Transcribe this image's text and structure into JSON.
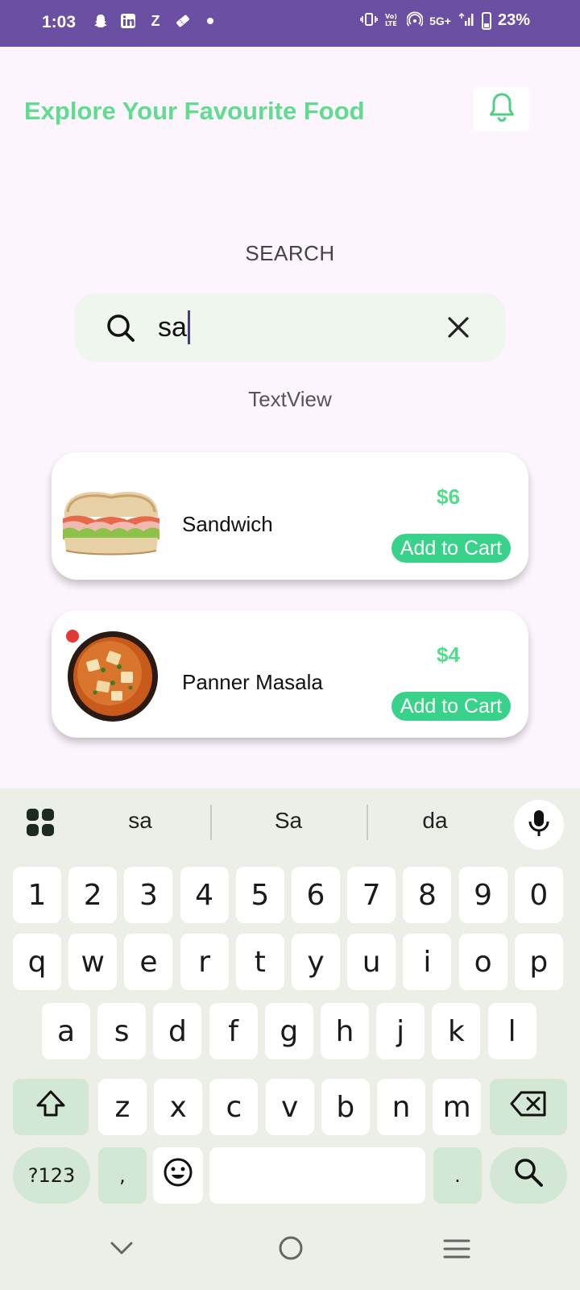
{
  "status_bar": {
    "time": "1:03",
    "left_icons": [
      "snapchat-icon",
      "linkedin-icon",
      "z-icon",
      "ticket-icon",
      "dot-icon"
    ],
    "z_label": "Z",
    "network": "5G+",
    "battery": "23%"
  },
  "header": {
    "title": "Explore Your Favourite Food",
    "notification_icon": "bell-icon"
  },
  "search": {
    "label": "SEARCH",
    "value": "sa",
    "helper": "TextView"
  },
  "results": [
    {
      "name": "Sandwich",
      "price": "$6",
      "button": "Add to Cart"
    },
    {
      "name": "Panner Masala",
      "price": "$4",
      "button": "Add to Cart"
    }
  ],
  "keyboard": {
    "suggestions": [
      "sa",
      "Sa",
      "da"
    ],
    "rows": {
      "numbers": [
        "1",
        "2",
        "3",
        "4",
        "5",
        "6",
        "7",
        "8",
        "9",
        "0"
      ],
      "row1": [
        "q",
        "w",
        "e",
        "r",
        "t",
        "y",
        "u",
        "i",
        "o",
        "p"
      ],
      "row2": [
        "a",
        "s",
        "d",
        "f",
        "g",
        "h",
        "j",
        "k",
        "l"
      ],
      "row3": [
        "z",
        "x",
        "c",
        "v",
        "b",
        "n",
        "m"
      ]
    },
    "symbols_key": "?123",
    "comma_key": ",",
    "period_key": "."
  },
  "colors": {
    "status_bar": "#6b4fa3",
    "accent_green": "#4fdd8a",
    "button_green": "#39d28a",
    "background": "#fdf5fd",
    "keyboard_bg": "#ebefe8"
  }
}
